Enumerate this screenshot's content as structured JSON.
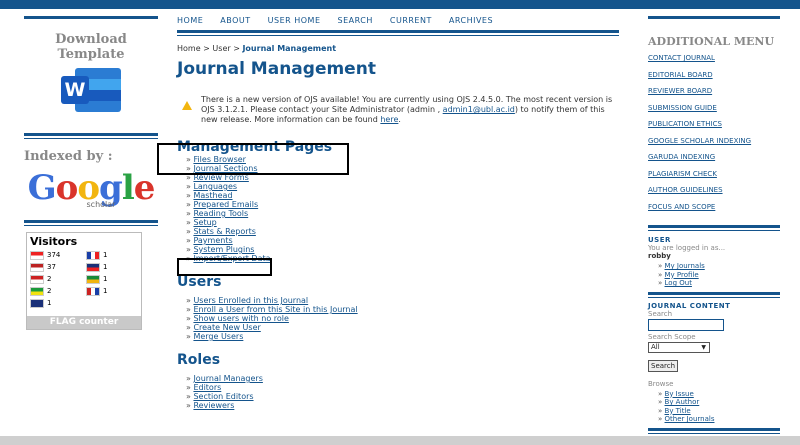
{
  "nav": [
    "HOME",
    "ABOUT",
    "USER HOME",
    "SEARCH",
    "CURRENT",
    "ARCHIVES"
  ],
  "breadcrumb": {
    "home": "Home",
    "sep": ">",
    "user": "User",
    "current": "Journal Management"
  },
  "page_title": "Journal Management",
  "notice": {
    "text1": "There is a new version of OJS available! You are currently using OJS 2.4.5.0. The most recent version is OJS 3.1.2.1. Please contact your Site Administrator (admin , ",
    "email": "admin1@ubl.ac.id",
    "text2": ") to notify them of this new release. More information can be found ",
    "here": "here",
    "end": "."
  },
  "sections": [
    {
      "title": "Management Pages",
      "links": [
        "Files Browser",
        "Journal Sections",
        "Review Forms",
        "Languages",
        "Masthead",
        "Prepared Emails",
        "Reading Tools",
        "Setup",
        "Stats & Reports",
        "Payments",
        "System Plugins",
        "Import/Export Data"
      ]
    },
    {
      "title": "Users",
      "links": [
        "Users Enrolled in this Journal",
        "Enroll a User from this Site in this Journal",
        "Show users with no role",
        "Create New User",
        "Merge Users"
      ]
    },
    {
      "title": "Roles",
      "links": [
        "Journal Managers",
        "Editors",
        "Section Editors",
        "Reviewers"
      ]
    }
  ],
  "left": {
    "download_title": "Download Template",
    "word_letter": "W",
    "indexed_title": "Indexed by :",
    "google": [
      "G",
      "o",
      "o",
      "g",
      "l",
      "e"
    ],
    "scholar": "scholar",
    "visitors_title": "Visitors",
    "visitors": [
      {
        "country": "ID",
        "count": "374",
        "colors": [
          "#e22",
          "#fff"
        ]
      },
      {
        "country": "FR",
        "count": "1",
        "colors": [
          "#1a3fa8",
          "#fff",
          "#e22"
        ]
      },
      {
        "country": "US",
        "count": "37",
        "colors": [
          "#b22",
          "#fff"
        ]
      },
      {
        "country": "GB",
        "count": "1",
        "colors": [
          "#1a3078",
          "#e22"
        ]
      },
      {
        "country": "MY",
        "count": "2",
        "colors": [
          "#c22",
          "#fff"
        ]
      },
      {
        "country": "ZA",
        "count": "1",
        "colors": [
          "#1a8a3a",
          "#f2b50f"
        ]
      },
      {
        "country": "BR",
        "count": "2",
        "colors": [
          "#1a9a3a",
          "#f2e20f"
        ]
      },
      {
        "country": "NL",
        "count": "1",
        "colors": [
          "#c22",
          "#fff",
          "#1a3fa8"
        ]
      },
      {
        "country": "AU",
        "count": "1",
        "colors": [
          "#1a3078",
          "#1a3078"
        ]
      }
    ],
    "flag_counter": "FLAG counter"
  },
  "right": {
    "menu_title": "ADDITIONAL MENU",
    "menu": [
      "CONTACT JOURNAL",
      "EDITORIAL BOARD",
      "REVIEWER BOARD",
      "SUBMISSION GUIDE",
      "PUBLICATION ETHICS",
      "GOOGLE SCHOLAR INDEXING",
      "GARUDA INDEXING",
      "PLAGIARISM CHECK",
      "AUTHOR GUIDELINES",
      "FOCUS AND SCOPE"
    ],
    "user_title": "USER",
    "logged_in": "You are logged in as...",
    "username": "robby",
    "user_links": [
      "My Journals",
      "My Profile",
      "Log Out"
    ],
    "content_title": "JOURNAL CONTENT",
    "search_label": "Search",
    "scope_label": "Search Scope",
    "scope_value": "All",
    "search_button": "Search",
    "browse_label": "Browse",
    "browse_links": [
      "By Issue",
      "By Author",
      "By Title",
      "Other Journals"
    ]
  },
  "colors": {
    "brand": "#14548c",
    "warning": "#f2b50f"
  }
}
